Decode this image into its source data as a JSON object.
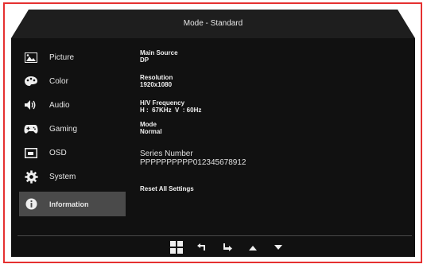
{
  "header": {
    "title": "Mode - Standard"
  },
  "menu": {
    "items": [
      {
        "label": "Picture",
        "icon": "picture-icon"
      },
      {
        "label": "Color",
        "icon": "color-palette-icon"
      },
      {
        "label": "Audio",
        "icon": "speaker-icon"
      },
      {
        "label": "Gaming",
        "icon": "gamepad-icon"
      },
      {
        "label": "OSD",
        "icon": "osd-icon"
      },
      {
        "label": "System",
        "icon": "gear-icon"
      },
      {
        "label": "Information",
        "icon": "info-icon",
        "active": true
      }
    ]
  },
  "info": {
    "main_source_label": "Main Source",
    "main_source_value": "DP",
    "resolution_label": "Resolution",
    "resolution_value": "1920x1080",
    "hv_frequency_label": "H/V Frequency",
    "hv_frequency_value": "H :  67KHz  V  : 60Hz",
    "mode_label": "Mode",
    "mode_value": "Normal",
    "series_number_label": "Series Number",
    "series_number_value": "PPPPPPPPPP012345678912",
    "reset_label": "Reset All Settings"
  },
  "footer": {
    "buttons": [
      "menu-grid-icon",
      "back-arrow-icon",
      "enter-arrow-icon",
      "up-arrow-icon",
      "down-arrow-icon"
    ]
  },
  "colors": {
    "panel_bg": "#111111",
    "header_bg": "#1e1e1e",
    "active_item_bg": "#4a4a4a",
    "frame_border": "#e53030"
  }
}
